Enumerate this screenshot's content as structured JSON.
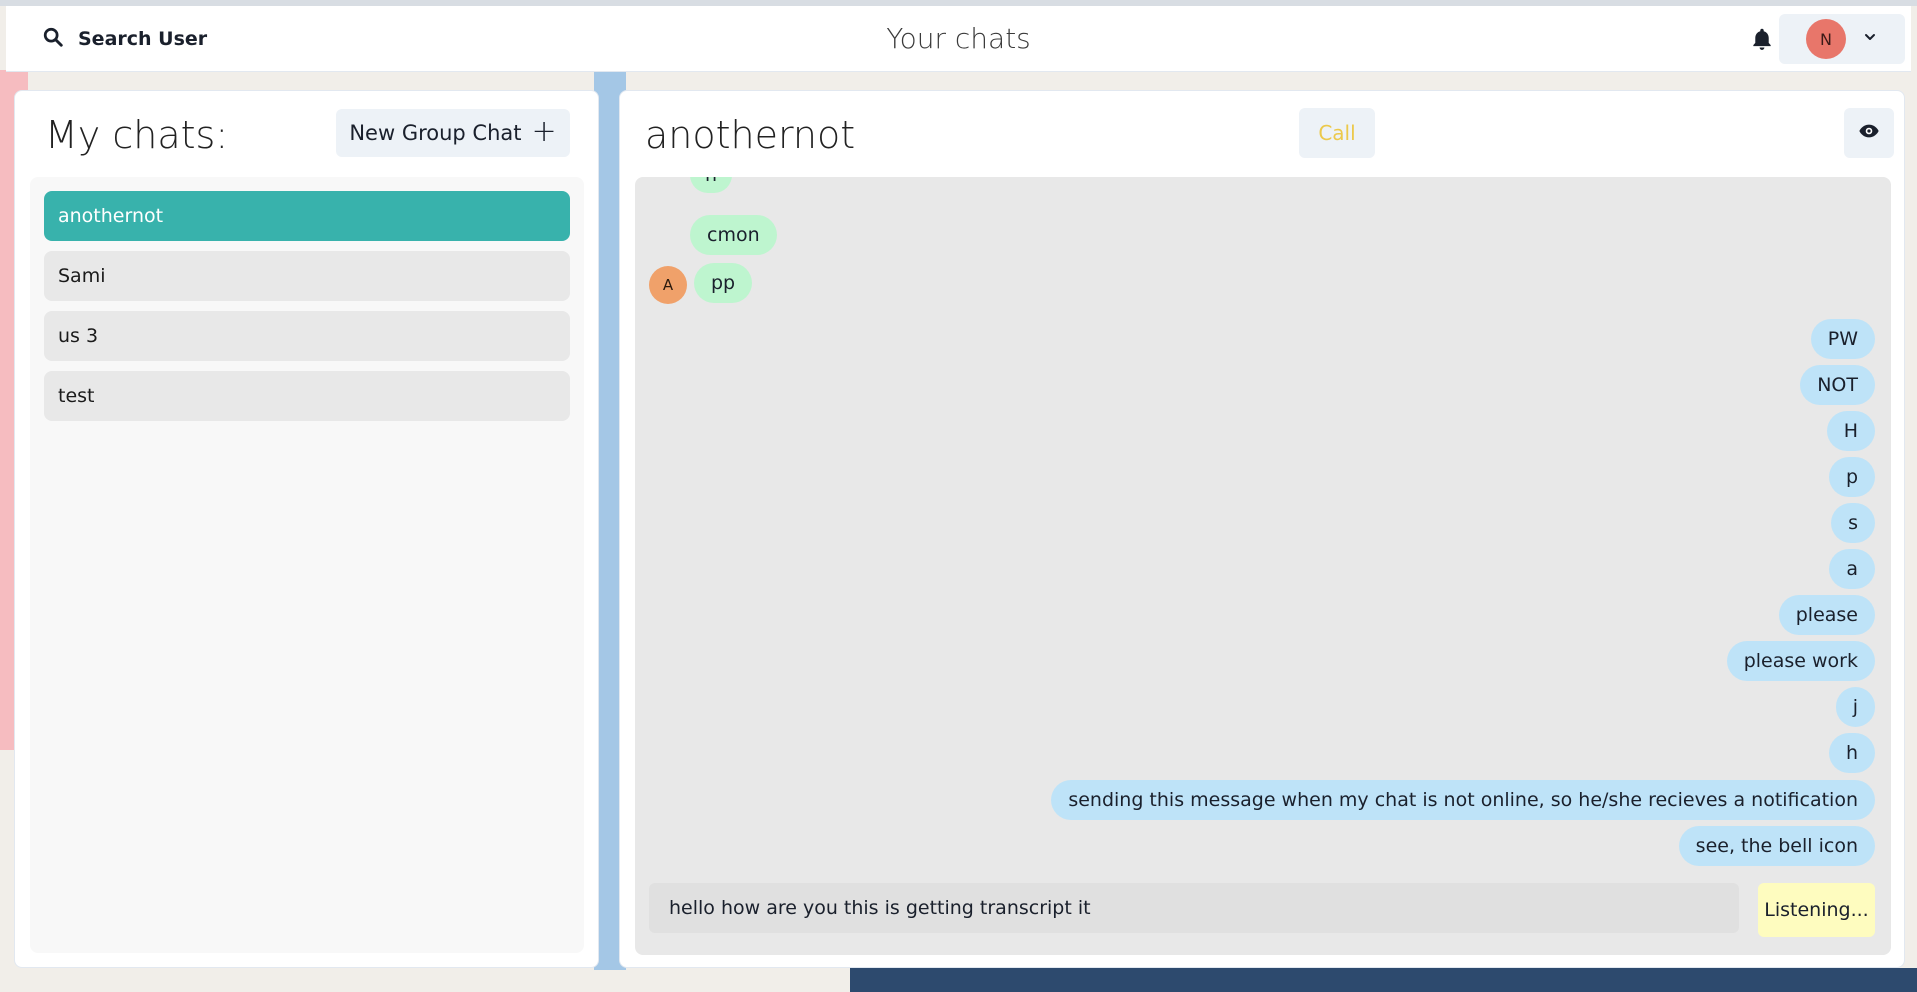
{
  "header": {
    "search_label": "Search User",
    "title": "Your chats",
    "profile_initial": "N"
  },
  "sidebar": {
    "title": "My chats:",
    "new_group_label": "New Group Chat",
    "chats": [
      {
        "name": "anothernot",
        "active": true
      },
      {
        "name": "Sami",
        "active": false
      },
      {
        "name": "us 3",
        "active": false
      },
      {
        "name": "test",
        "active": false
      }
    ]
  },
  "chat": {
    "name": "anothernot",
    "call_label": "Call",
    "sender_initial": "A",
    "messages_in": [
      "h",
      "cmon",
      "pp"
    ],
    "messages_out": [
      "PW",
      "NOT",
      "H",
      "p",
      "s",
      "a",
      "please",
      "please work",
      "j",
      "h",
      "sending this message when my chat is not online, so he/she recieves a notification",
      "see, the bell icon"
    ],
    "composer_value": "hello how are you this is getting transcript it",
    "listen_label": "Listening..."
  },
  "colors": {
    "accent": "#38b2ac",
    "incoming_bubble": "#bef5cf",
    "outgoing_bubble": "#bee3f8",
    "call_text": "#ecc94b"
  }
}
